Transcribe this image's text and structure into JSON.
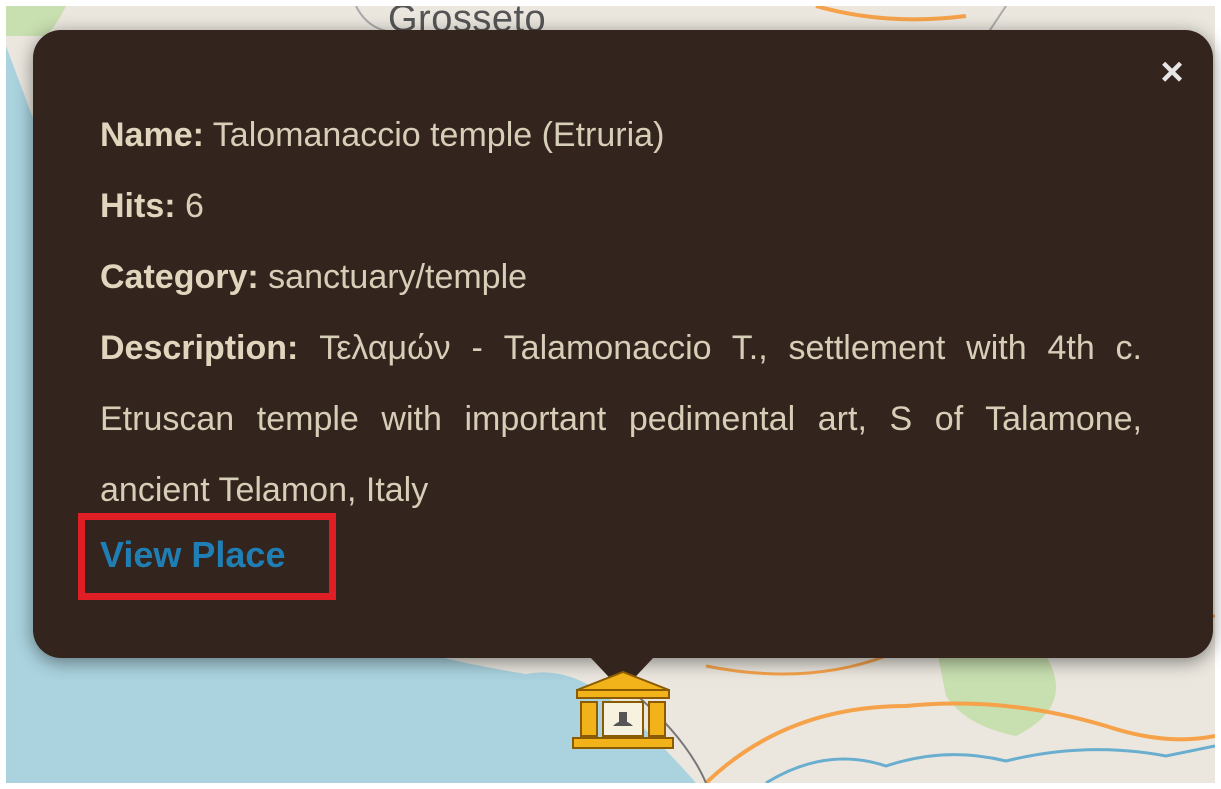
{
  "map": {
    "place_label": "Grosseto",
    "colors": {
      "land": "#ebe7df",
      "sea": "#aad3df",
      "road": "#f5a24a",
      "green": "#c8dfb0"
    }
  },
  "popup": {
    "close_label": "×",
    "fields": {
      "name_label": "Name:",
      "name_value": "Talomanaccio temple (Etruria)",
      "hits_label": "Hits:",
      "hits_value": "6",
      "category_label": "Category:",
      "category_value": "sanctuary/temple",
      "description_label": "Description:",
      "description_value": "Τελαμών - Talamonaccio T., settlement with 4th c. Etruscan temple with important pedimental art, S of Talamone, ancient Telamon, Italy"
    },
    "link_label": "View Place",
    "background_color": "#33241d",
    "link_color": "#1f7fb5",
    "highlight_color": "#e01e26"
  },
  "marker": {
    "icon": "temple-icon",
    "color": "#f2b21a"
  }
}
